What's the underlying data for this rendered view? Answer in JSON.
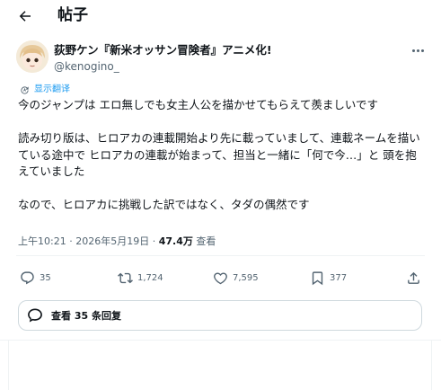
{
  "header": {
    "title": "帖子"
  },
  "author": {
    "name": "荻野ケン『新米オッサン冒険者』アニメ化!",
    "handle": "@kenogino_"
  },
  "translate_label": "显示翻译",
  "tweet": {
    "paragraphs": [
      "今のジャンプは エロ無しでも女主人公を描かせてもらえて羨ましいです",
      "読み切り版は、ヒロアカの連載開始より先に載っていまして、連載ネームを描いている途中で ヒロアカの連載が始まって、担当と一緒に「何で今…」と 頭を抱えていました",
      "なので、ヒロアカに挑戦した訳ではなく、タダの偶然です"
    ]
  },
  "meta": {
    "time": "上午10:21",
    "separator": "·",
    "date": "2026年5月19日",
    "views_count": "47.4万",
    "views_label": "查看"
  },
  "actions": {
    "reply_count": "35",
    "retweet_count": "1,724",
    "like_count": "7,595",
    "bookmark_count": "377"
  },
  "replies_button": {
    "label": "查看 35 条回复"
  },
  "icons": {
    "back": "arrow-left-icon",
    "more": "more-horizontal-icon",
    "translate": "translate-icon",
    "reply": "reply-icon",
    "retweet": "retweet-icon",
    "like": "heart-icon",
    "bookmark": "bookmark-icon",
    "share": "share-icon",
    "replies": "speech-bubble-icon"
  },
  "colors": {
    "accent": "#1d9bf0",
    "text": "#0f1419",
    "secondary": "#536471",
    "border": "#cfd9de"
  }
}
